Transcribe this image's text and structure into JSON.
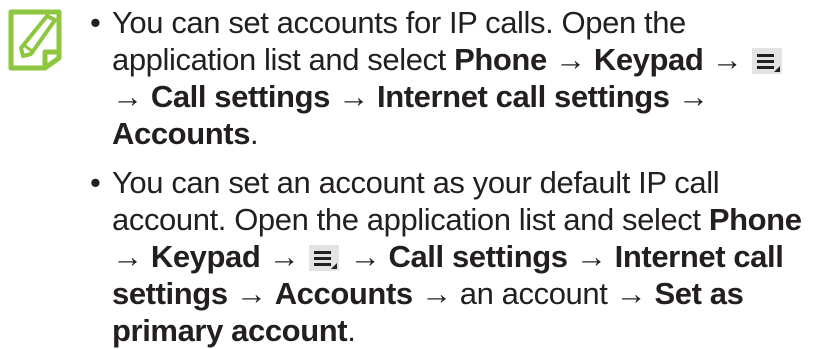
{
  "colors": {
    "note_icon": "#8dc63f",
    "text": "#231f20",
    "menu_icon_bg": "#e3e3e3"
  },
  "icons": {
    "note": "note-pencil-icon",
    "menu": "menu-icon"
  },
  "tips": [
    {
      "t1": "You can set accounts for IP calls. Open the application list and select ",
      "b1": "Phone",
      "a1": " → ",
      "b2": "Keypad",
      "a2": " → ",
      "a3": " → ",
      "b3": "Call settings",
      "a4": " → ",
      "b4": "Internet call settings",
      "a5": " → ",
      "b5": "Accounts",
      "end": "."
    },
    {
      "t1": "You can set an account as your default IP call account. Open the application list and select ",
      "b1": "Phone",
      "a1": " → ",
      "b2": "Keypad",
      "a2": " → ",
      "a3": " → ",
      "b3": "Call settings",
      "a4": " → ",
      "b4": "Internet call settings",
      "a5": " → ",
      "b5": "Accounts",
      "t2": " → an account → ",
      "b6": "Set as primary account",
      "end": "."
    }
  ]
}
